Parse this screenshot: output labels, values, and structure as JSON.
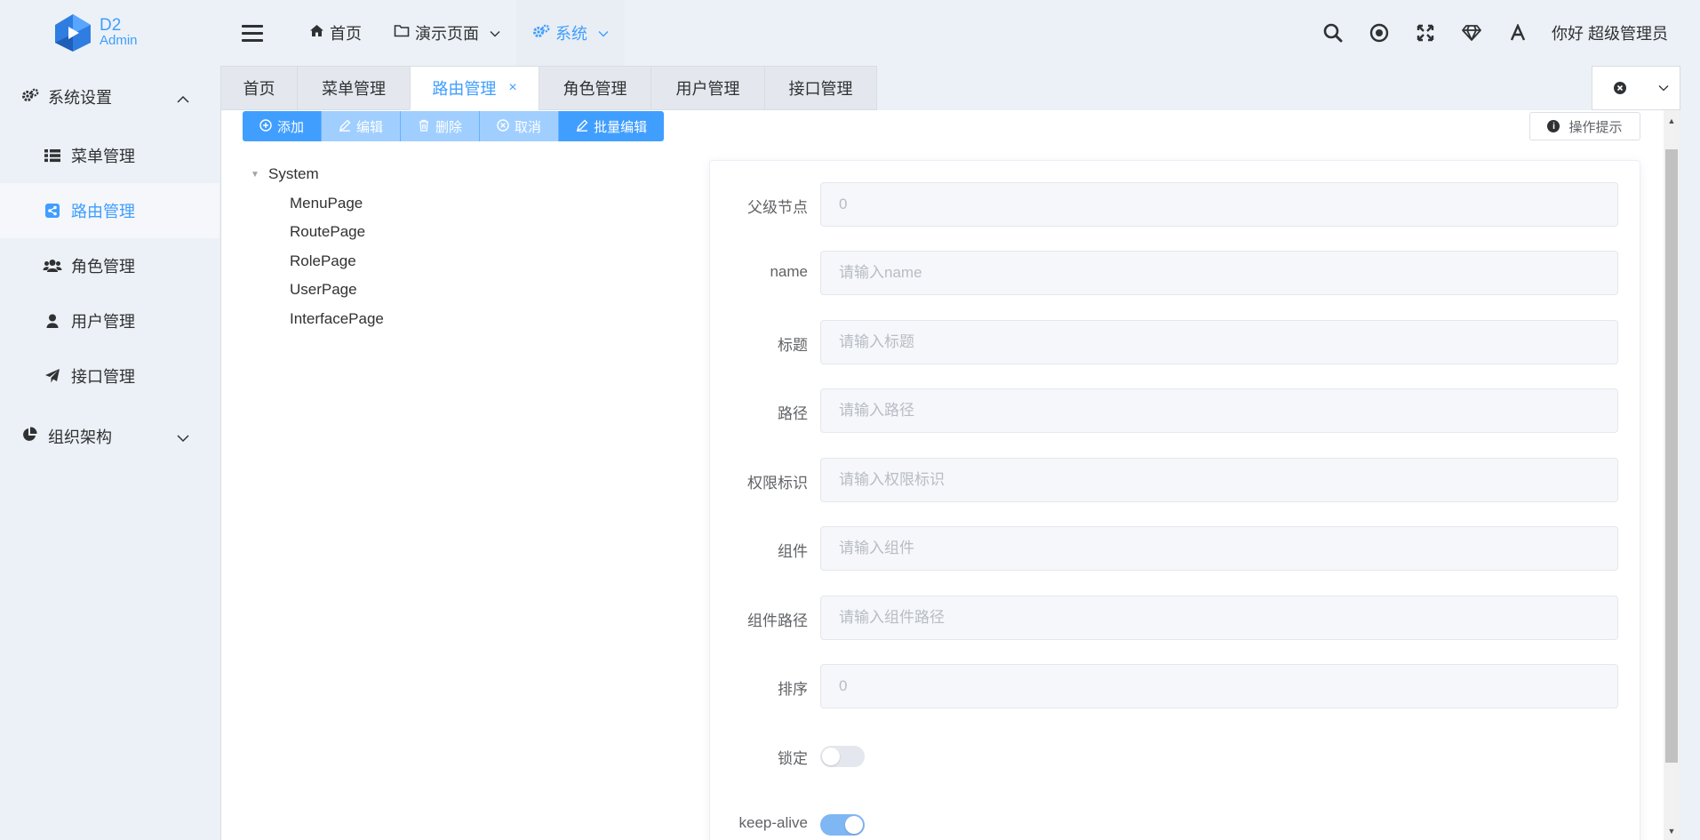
{
  "brand": {
    "line1": "D2",
    "line2": "Admin"
  },
  "header": {
    "nav": [
      {
        "label": "首页",
        "icon": "home-icon"
      },
      {
        "label": "演示页面",
        "icon": "folder-icon"
      },
      {
        "label": "系统",
        "icon": "cogs-icon",
        "active": true
      }
    ],
    "greeting": "你好 超级管理员",
    "icons": [
      "search-icon",
      "record-icon",
      "fullscreen-icon",
      "diamond-icon",
      "font-size-icon"
    ]
  },
  "sidebar": {
    "group1": "系统设置",
    "items": [
      {
        "label": "菜单管理",
        "icon": "list-icon"
      },
      {
        "label": "路由管理",
        "icon": "share-icon",
        "active": true
      },
      {
        "label": "角色管理",
        "icon": "users-icon"
      },
      {
        "label": "用户管理",
        "icon": "user-icon"
      },
      {
        "label": "接口管理",
        "icon": "paper-plane-icon"
      }
    ],
    "group2": "组织架构"
  },
  "tabs": [
    {
      "label": "首页"
    },
    {
      "label": "菜单管理"
    },
    {
      "label": "路由管理",
      "active": true,
      "closable": true
    },
    {
      "label": "角色管理"
    },
    {
      "label": "用户管理"
    },
    {
      "label": "接口管理"
    }
  ],
  "toolbar": {
    "add": "添加",
    "edit": "编辑",
    "delete": "删除",
    "cancel": "取消",
    "batch_edit": "批量编辑"
  },
  "hint_button": "操作提示",
  "tree": {
    "root": "System",
    "children": [
      "MenuPage",
      "RoutePage",
      "RolePage",
      "UserPage",
      "InterfacePage"
    ]
  },
  "form": {
    "parent": {
      "label": "父级节点",
      "value": "0"
    },
    "name": {
      "label": "name",
      "placeholder": "请输入name"
    },
    "title": {
      "label": "标题",
      "placeholder": "请输入标题"
    },
    "path": {
      "label": "路径",
      "placeholder": "请输入路径"
    },
    "permission": {
      "label": "权限标识",
      "placeholder": "请输入权限标识"
    },
    "component": {
      "label": "组件",
      "placeholder": "请输入组件"
    },
    "component_path": {
      "label": "组件路径",
      "placeholder": "请输入组件路径"
    },
    "sort": {
      "label": "排序",
      "value": "0"
    },
    "locked": {
      "label": "锁定",
      "on": false
    },
    "keep_alive": {
      "label": "keep-alive",
      "on": true
    }
  },
  "colors": {
    "primary": "#409eff",
    "primary_disabled": "#a0cfff",
    "sidebar_bg": "#ebf1f6"
  }
}
